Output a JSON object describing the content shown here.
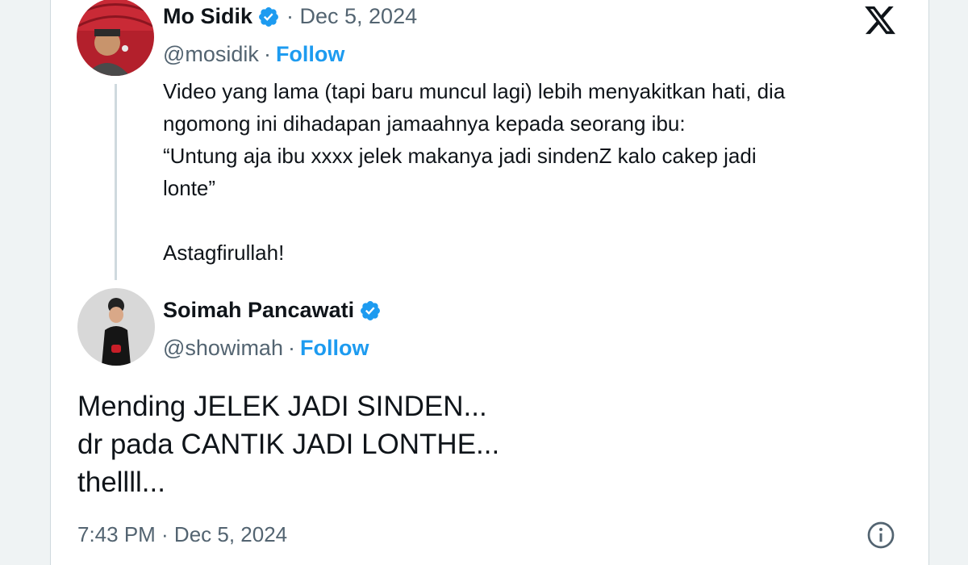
{
  "quoted_tweet": {
    "author_name": "Mo Sidik",
    "date": "· Dec 5, 2024",
    "handle": "@mosidik",
    "separator": "·",
    "follow_label": "Follow",
    "text_lines": [
      "Video yang lama (tapi baru muncul lagi) lebih menyakitkan hati, dia",
      "ngomong ini dihadapan jamaahnya kepada seorang ibu:",
      "“Untung aja ibu xxxx jelek makanya jadi sindenZ kalo cakep jadi",
      "lonte”",
      "Astagfirullah!"
    ]
  },
  "reply_tweet": {
    "author_name": "Soimah Pancawati",
    "handle": "@showimah",
    "separator": "·",
    "follow_label": "Follow",
    "text_lines": [
      "Mending JELEK JADI SINDEN...",
      "dr pada CANTIK JADI LONTHE...",
      "thellll..."
    ],
    "timestamp": "7:43 PM · Dec 5, 2024"
  },
  "icons": {
    "verified": "verified-badge-icon",
    "brand": "x-logo-icon",
    "info": "info-icon"
  },
  "colors": {
    "accent": "#1d9bf0",
    "secondary_text": "#536471",
    "primary_text": "#0f1419"
  }
}
